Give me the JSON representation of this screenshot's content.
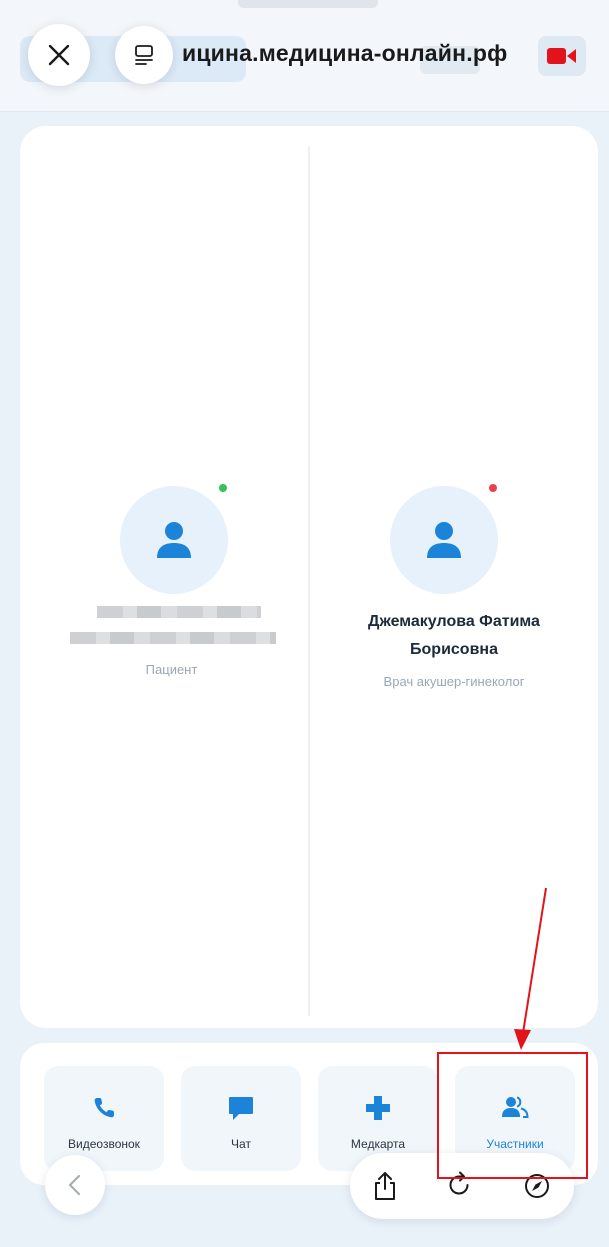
{
  "browser": {
    "url": "ицина.медицина-онлайн.рф"
  },
  "participants": {
    "patient": {
      "role": "Пациент",
      "status_color": "#35c25a"
    },
    "doctor": {
      "name_line1": "Джемакулова Фатима",
      "name_line2": "Борисовна",
      "role": "Врач акушер-гинеколог",
      "status_color": "#e8414b"
    }
  },
  "toolbar": {
    "items": [
      {
        "label": "Видеозвонок",
        "icon": "phone-icon"
      },
      {
        "label": "Чат",
        "icon": "chat-icon"
      },
      {
        "label": "Медкарта",
        "icon": "plus-icon"
      },
      {
        "label": "Участники",
        "icon": "participants-icon",
        "active": true
      }
    ]
  },
  "colors": {
    "accent": "#1b84d8",
    "annotation": "#e3131b"
  }
}
